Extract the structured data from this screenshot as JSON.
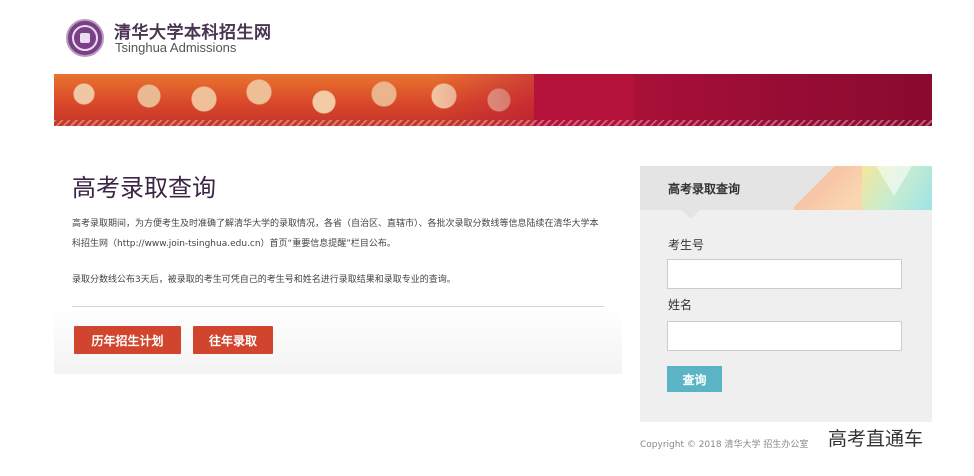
{
  "header": {
    "site_title": "清华大学本科招生网",
    "site_subtitle": "Tsinghua Admissions"
  },
  "main": {
    "title": "高考录取查询",
    "paragraph1": "高考录取期间，为方便考生及时准确了解清华大学的录取情况，各省（自治区、直辖市）、各批次录取分数线等信息陆续在清华大学本科招生网（http://www.join-tsinghua.edu.cn）首页“重要信息提醒”栏目公布。",
    "paragraph2": "录取分数线公布3天后，被录取的考生可凭自己的考生号和姓名进行录取结果和录取专业的查询。",
    "buttons": {
      "plan_label": "历年招生计划",
      "past_label": "往年录取"
    }
  },
  "sidebar": {
    "title": "高考录取查询",
    "exam_id_label": "考生号",
    "exam_id_value": "",
    "name_label": "姓名",
    "name_value": "",
    "submit_label": "查询"
  },
  "footer": {
    "copyright": "Copyright © 2018 清华大学 招生办公室"
  },
  "watermark": "高考直通车",
  "colors": {
    "primary_red": "#d1452e",
    "query_blue": "#5ab4c5",
    "title_purple": "#3b2446"
  }
}
